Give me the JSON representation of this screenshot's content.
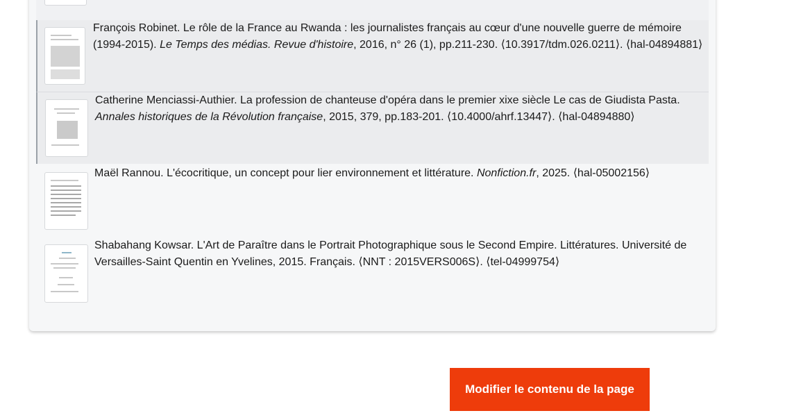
{
  "publications": [
    {
      "authors": "François Robinet.",
      "title": " Le rôle de la France au Rwanda : les journalistes français au cœur d'une nouvelle guerre de mémoire (1994-2015). ",
      "journal": "Le Temps des médias. Revue d'histoire",
      "details": ", 2016, n° 26 (1), pp.211-230. ⟨10.3917/tdm.026.0211⟩. ⟨hal-04894881⟩"
    },
    {
      "authors": "Catherine Menciassi-Authier.",
      "title": " La profession de chanteuse d'opéra dans le premier xixe siècle Le cas de Giudista Pasta. ",
      "journal": "Annales historiques de la Révolution française",
      "details": ", 2015, 379, pp.183-201. ⟨10.4000/ahrf.13447⟩. ⟨hal-04894880⟩"
    },
    {
      "authors": "Maël Rannou.",
      "title": " L'écocritique, un concept pour lier environnement et littérature. ",
      "journal": "Nonfiction.fr",
      "details": ", 2025. ⟨hal-05002156⟩"
    },
    {
      "authors": "Shabahang Kowsar.",
      "title": " L'Art de Paraître dans le Portrait Photographique sous le Second Empire. Littératures. Université de Versailles-Saint Quentin en Yvelines, 2015. Français. ⟨NNT : 2015VERS006S⟩. ⟨tel-04999754⟩",
      "journal": "",
      "details": ""
    }
  ],
  "edit_button": {
    "label": "Modifier le contenu de la page"
  },
  "colors": {
    "accent": "#ee3c0b",
    "panel": "#f6f7f8",
    "highlight": "#ebecee"
  }
}
